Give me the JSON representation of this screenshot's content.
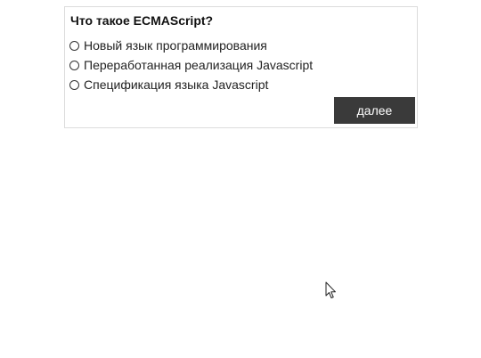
{
  "quiz": {
    "question": "Что такое ECMAScript?",
    "options": [
      {
        "label": "Новый язык программирования",
        "selected": false
      },
      {
        "label": "Переработанная реализация Javascript",
        "selected": false
      },
      {
        "label": "Спецификация языка Javascript",
        "selected": false
      }
    ],
    "next_label": "далее"
  },
  "colors": {
    "button_background": "#3a3a3a",
    "button_text": "#ffffff",
    "card_border": "#dcdcdc"
  },
  "icons": {
    "cursor": "mouse-pointer-icon"
  }
}
